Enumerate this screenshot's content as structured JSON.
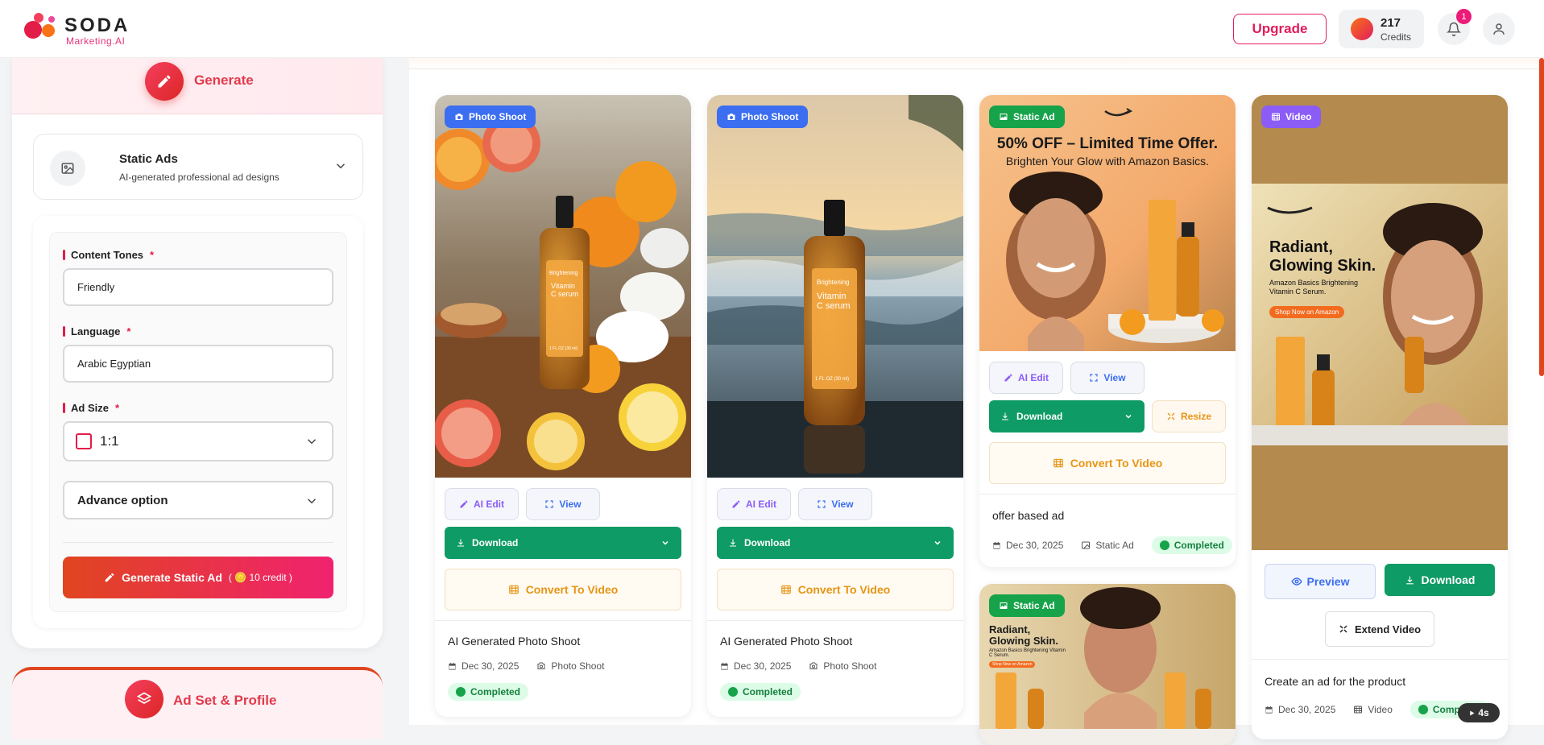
{
  "topbar": {
    "logo_text": "SODA",
    "logo_sub": "Marketing.AI",
    "upgrade_label": "Upgrade",
    "credits_value": "217",
    "credits_label": "Credits",
    "notification_count": "1"
  },
  "sidebar": {
    "generate_label": "Generate",
    "static_ads_title": "Static Ads",
    "static_ads_sub": "AI-generated professional ad designs",
    "content_tones_label": "Content Tones",
    "content_tones_value": "Friendly",
    "language_label": "Language",
    "language_value": "Arabic Egyptian",
    "ad_size_label": "Ad Size",
    "ad_size_value": "1:1",
    "advance_option_label": "Advance option",
    "required_mark": "*",
    "generate_button_label": "Generate Static Ad",
    "generate_button_credit": "( 🪙 10 credit )",
    "adset_label": "Ad Set & Profile"
  },
  "cards": [
    {
      "tag": "Photo Shoot",
      "ai_edit": "AI Edit",
      "view": "View",
      "download": "Download",
      "convert": "Convert To Video",
      "title": "AI Generated Photo Shoot",
      "date": "Dec 30, 2025",
      "type": "Photo Shoot",
      "status": "Completed"
    },
    {
      "tag": "Photo Shoot",
      "ai_edit": "AI Edit",
      "view": "View",
      "download": "Download",
      "convert": "Convert To Video",
      "title": "AI Generated Photo Shoot",
      "date": "Dec 30, 2025",
      "type": "Photo Shoot",
      "status": "Completed"
    },
    {
      "tag": "Static Ad",
      "headline": "50% OFF – Limited Time Offer.",
      "subheadline": "Brighten Your Glow with Amazon Basics.",
      "ai_edit": "AI Edit",
      "view": "View",
      "download": "Download",
      "resize": "Resize",
      "convert": "Convert To Video",
      "title": "offer based ad",
      "date": "Dec 30, 2025",
      "type": "Static Ad",
      "status": "Completed"
    },
    {
      "tag": "Static Ad",
      "headline": "Radiant, Glowing Skin.",
      "subheadline": "Amazon Basics Brightening Vitamin C Serum.",
      "cta": "Shop Now on Amazon"
    },
    {
      "tag": "Video",
      "headline": "Radiant, Glowing Skin.",
      "subheadline": "Amazon Basics Brightening Vitamin C Serum.",
      "cta": "Shop Now on Amazon",
      "preview": "Preview",
      "download": "Download",
      "extend": "Extend Video",
      "title": "Create an ad for the product",
      "date": "Dec 30, 2025",
      "type": "Video",
      "status": "Completed",
      "duration": "4s"
    }
  ],
  "product_label": {
    "brand": "Brightening",
    "name": "Vitamin C serum",
    "size": "1 FL OZ (30 ml)"
  },
  "colors": {
    "brand": "#e11d5c",
    "accent_orange": "#e0451f",
    "download_green": "#0f9b65",
    "status_green": "#16a34a",
    "tag_blue": "#3b6ef0",
    "tag_purple": "#8b5cf6"
  }
}
